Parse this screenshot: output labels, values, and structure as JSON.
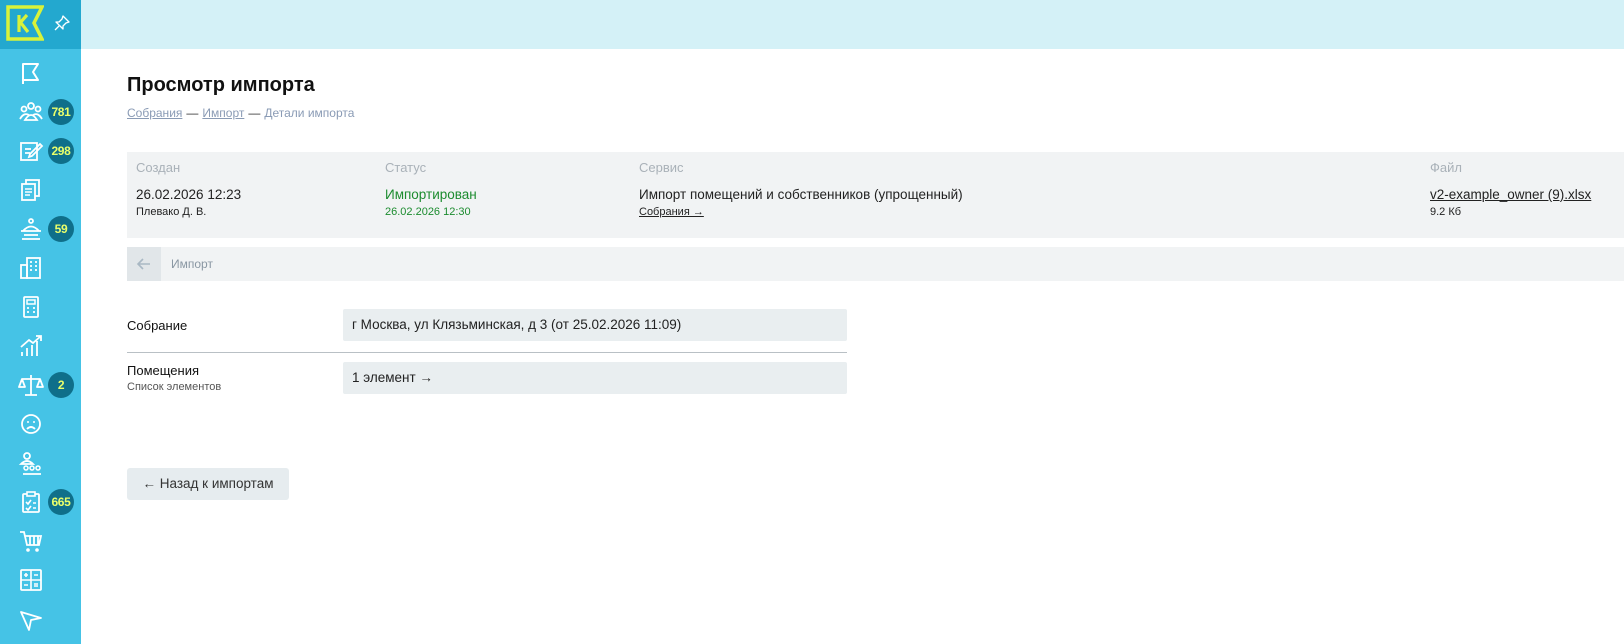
{
  "sidebar": {
    "logo_letter": "K",
    "items": [
      {
        "icon": "flag-icon",
        "badge": ""
      },
      {
        "icon": "meeting-icon",
        "badge": "781"
      },
      {
        "icon": "edit-document-icon",
        "badge": "298"
      },
      {
        "icon": "documents-icon",
        "badge": ""
      },
      {
        "icon": "service-bell-icon",
        "badge": "59"
      },
      {
        "icon": "building-icon",
        "badge": ""
      },
      {
        "icon": "calculator-icon",
        "badge": ""
      },
      {
        "icon": "chart-icon",
        "badge": ""
      },
      {
        "icon": "scales-icon",
        "badge": "2"
      },
      {
        "icon": "sad-face-icon",
        "badge": ""
      },
      {
        "icon": "people-group-icon",
        "badge": ""
      },
      {
        "icon": "checklist-icon",
        "badge": "665"
      },
      {
        "icon": "cart-icon",
        "badge": ""
      },
      {
        "icon": "calculator-grid-icon",
        "badge": ""
      },
      {
        "icon": "send-icon",
        "badge": ""
      }
    ]
  },
  "page": {
    "title": "Просмотр импорта",
    "breadcrumb": {
      "item1": "Собрания",
      "sep": "—",
      "item2": "Импорт",
      "current": "Детали импорта"
    }
  },
  "info": {
    "created_head": "Создан",
    "created_date": "26.02.2026 12:23",
    "created_by": "Плевако Д. В.",
    "status_head": "Статус",
    "status_value": "Импортирован",
    "status_date": "26.02.2026 12:30",
    "service_head": "Сервис",
    "service_value": "Импорт помещений и собственников (упрощенный)",
    "service_link": "Собрания →",
    "file_head": "Файл",
    "file_name": "v2-example_owner (9).xlsx",
    "file_size": "9.2 Кб"
  },
  "backbar": {
    "label": "Импорт"
  },
  "form": {
    "meeting_label": "Собрание",
    "meeting_value": "г Москва, ул Клязьминская, д 3 (от 25.02.2026 11:09)",
    "rooms_label": "Помещения",
    "rooms_sublabel": "Список элементов",
    "rooms_value": "1 элемент →"
  },
  "actions": {
    "back_to_imports": "← Назад к импортам"
  },
  "colors": {
    "sidebar": "#45c3e6",
    "sidebar_top": "#23a8cf",
    "topbar": "#d4f1f7",
    "badge_bg": "#0f6f8a",
    "badge_text": "#eaff6a",
    "status_green": "#1c8c2f"
  }
}
